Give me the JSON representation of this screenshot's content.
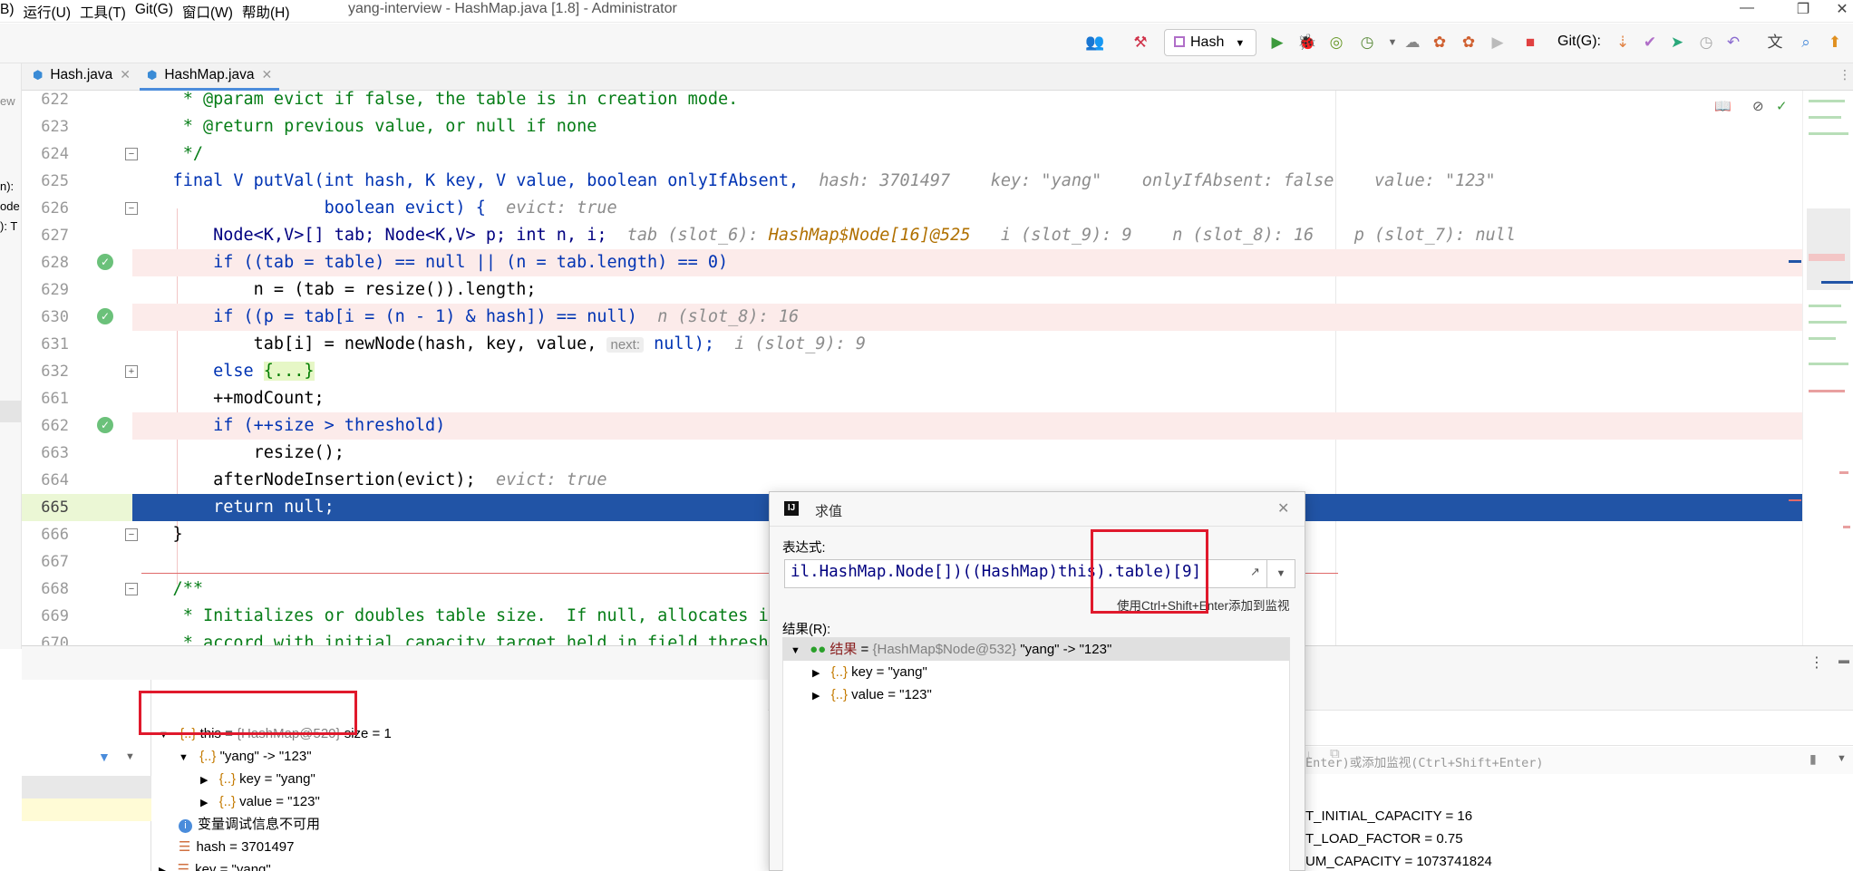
{
  "menu": [
    "B)",
    "运行(U)",
    "工具(T)",
    "Git(G)",
    "窗口(W)",
    "帮助(H)"
  ],
  "window_title": "yang-interview - HashMap.java [1.8] - Administrator",
  "window_buttons": {
    "minimize": "—",
    "restore": "❐",
    "close": "✕"
  },
  "toolbar": {
    "run_config": "Hash",
    "git_label": "Git(G):"
  },
  "tabs": [
    {
      "label": "Hash.java",
      "active": false
    },
    {
      "label": "HashMap.java",
      "active": true
    }
  ],
  "left_strip": [
    "ew",
    "n):",
    "ode",
    "): T"
  ],
  "line_numbers": [
    "622",
    "623",
    "624",
    "625",
    "626",
    "627",
    "628",
    "629",
    "630",
    "631",
    "632",
    "661",
    "662",
    "663",
    "664",
    "665",
    "666",
    "667",
    "668",
    "669",
    "670"
  ],
  "code": {
    "l622": "     * @param evict if false, the table is in creation mode.",
    "l623": "     * @return previous value, or null if none",
    "l624": "     */",
    "l625_a": "    final V putVal(int hash, K key, V value, boolean onlyIfAbsent,",
    "l625_hint": "hash: 3701497    key: \"yang\"    onlyIfAbsent: false    value: \"123\"",
    "l626_a": "                   boolean evict) {",
    "l626_hint": "evict: true",
    "l627_a": "        Node<K,V>[] tab; Node<K,V> p; int n, i;",
    "l627_hint1": "tab (slot_6):",
    "l627_hint2": "HashMap$Node[16]@525",
    "l627_hint3": "i (slot_9): 9    n (slot_8): 16    p (slot_7): null",
    "l628": "        if ((tab = table) == null || (n = tab.length) == 0)",
    "l629": "            n = (tab = resize()).length;",
    "l630_a": "        if ((p = tab[i = (n - 1) & hash]) == null)",
    "l630_hint": "n (slot_8): 16",
    "l631_a": "            tab[i] = newNode(hash, key, value, ",
    "l631_pill": "next:",
    "l631_b": "null);",
    "l631_hint": "i (slot_9): 9",
    "l632_a": "        else ",
    "l632_fold": "{...}",
    "l661": "        ++modCount;",
    "l662": "        if (++size > threshold)",
    "l663": "            resize();",
    "l664_a": "        afterNodeInsertion(evict);",
    "l664_hint": "evict: true",
    "l665": "        return null;",
    "l666": "    }",
    "l667": "",
    "l668": "    /**",
    "l669": "     * Initializes or doubles table size.  If null, allocates i",
    "l670": "     * accord with initial capacity target held in field thresh"
  },
  "variables": {
    "this_row": {
      "name": "this",
      "value": "{HashMap@520}",
      "extra": "size = 1"
    },
    "entry_row": "\"yang\" -> \"123\"",
    "key_row": "key = \"yang\"",
    "value_row": "value = \"123\"",
    "info_row": "变量调试信息不可用",
    "hash_row": "hash = 3701497",
    "keyvar_row": "key = \"yang\""
  },
  "dialog": {
    "title": "求值",
    "expr_label": "表达式:",
    "expression": "il.HashMap.Node[])((HashMap)this).table)[9]",
    "hint": "使用Ctrl+Shift+Enter添加到监视",
    "result_label": "结果(R):",
    "result_row": {
      "name": "结果",
      "obj": "{HashMap$Node@532}",
      "val": "\"yang\" -> \"123\""
    },
    "child_key": "key = \"yang\"",
    "child_value": "value = \"123\""
  },
  "watches": {
    "placeholder": "Enter)或添加监视(Ctrl+Shift+Enter)",
    "rows": [
      "T_INITIAL_CAPACITY = 16",
      "T_LOAD_FACTOR = 0.75",
      "UM_CAPACITY = 1073741824"
    ]
  },
  "colors": {
    "accent": "#2154a6",
    "highlight": "#fcebea",
    "annotation": "#e0192c"
  }
}
